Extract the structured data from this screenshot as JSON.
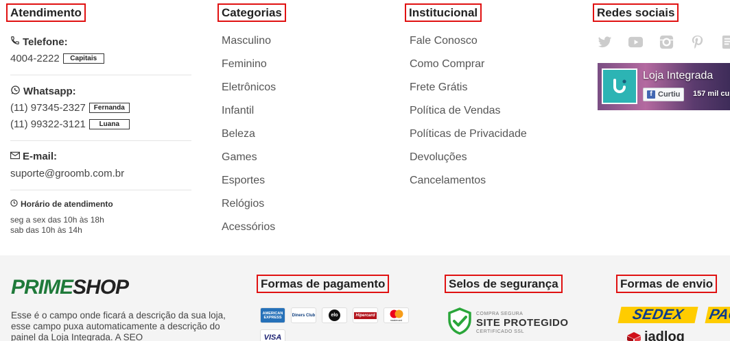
{
  "atendimento": {
    "heading": "Atendimento",
    "telefone_label": "Telefone:",
    "telefone_number": "4004-2222",
    "telefone_badge": "Capitais",
    "whatsapp_label": "Whatsapp:",
    "whatsapp": [
      {
        "number": "(11) 97345-2327",
        "badge": "Fernanda"
      },
      {
        "number": "(11) 99322-3121",
        "badge": "Luana"
      }
    ],
    "email_label": "E-mail:",
    "email": "suporte@groomb.com.br",
    "horario_label": "Horário de atendimento",
    "horario_lines": [
      "seg a sex das 10h às 18h",
      "sab das 10h às 14h"
    ]
  },
  "categorias": {
    "heading": "Categorias",
    "items": [
      "Masculino",
      "Feminino",
      "Eletrônicos",
      "Infantil",
      "Beleza",
      "Games",
      "Esportes",
      "Relógios",
      "Acessórios"
    ]
  },
  "institucional": {
    "heading": "Institucional",
    "items": [
      "Fale Conosco",
      "Como Comprar",
      "Frete Grátis",
      "Política de Vendas",
      "Políticas de Privacidade",
      "Devoluções",
      "Cancelamentos"
    ]
  },
  "redes": {
    "heading": "Redes sociais",
    "icons": [
      "twitter-icon",
      "youtube-icon",
      "instagram-icon",
      "pinterest-icon",
      "blog-icon"
    ],
    "facebook": {
      "page_name": "Loja Integrada",
      "like_label": "Curtiu",
      "likes": "157 mil cu"
    }
  },
  "footer": {
    "brand_part1": "PRIME",
    "brand_part2": "SHOP",
    "description": "Esse é o campo onde ficará a descrição da sua loja, esse campo puxa automaticamente a descrição do painel da Loja Integrada. A SEO",
    "pagamento_heading": "Formas de pagamento",
    "pagamento_cards": [
      "AMERICAN EXPRESS",
      "Diners Club",
      "elo",
      "Hipercard",
      "mastercard",
      "VISA"
    ],
    "seguranca_heading": "Selos de segurança",
    "seal": {
      "line1": "COMPRA SEGURA",
      "line2": "SITE PROTEGIDO",
      "line3": "CERTIFICADO SSL"
    },
    "envio_heading": "Formas de envio",
    "shipping": [
      "SEDEX",
      "PAC",
      "jadlog"
    ]
  },
  "colors": {
    "heading_border": "#e01010",
    "brand_green": "#1f7a3a",
    "sedex_yellow": "#ffcc00",
    "sedex_blue": "#0b3b8c",
    "fb_teal": "#2cb4b4"
  }
}
